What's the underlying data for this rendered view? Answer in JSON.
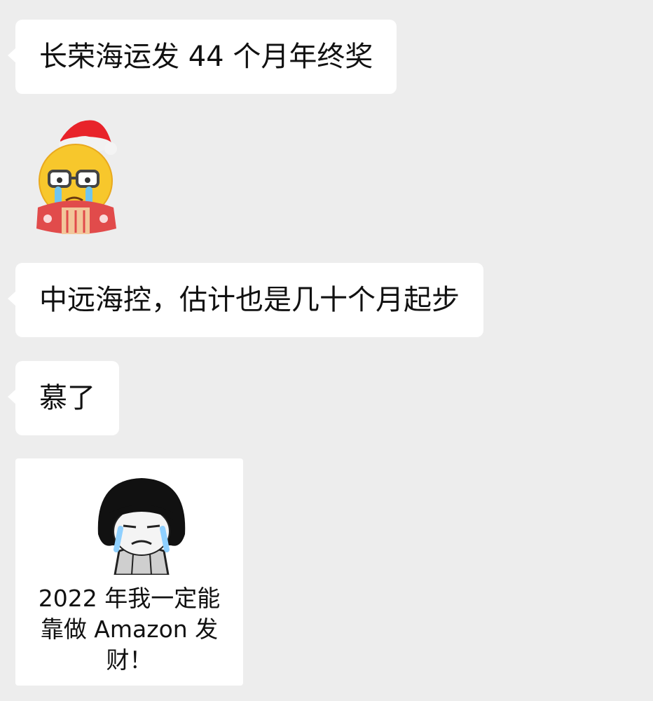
{
  "chat": {
    "messages": [
      {
        "type": "text",
        "text": "长荣海运发 44 个月年终奖"
      },
      {
        "type": "sticker",
        "icon": "crying-santa-emoji-icon"
      },
      {
        "type": "text",
        "text": "中远海控，估计也是几十个月起步"
      },
      {
        "type": "text",
        "text": "慕了"
      },
      {
        "type": "meme",
        "icon": "crying-bowl-cut-meme-icon",
        "caption": "2022 年我一定能\n靠做 Amazon 发\n财！"
      }
    ]
  },
  "colors": {
    "background": "#ededed",
    "bubble": "#ffffff",
    "text": "#111111"
  }
}
